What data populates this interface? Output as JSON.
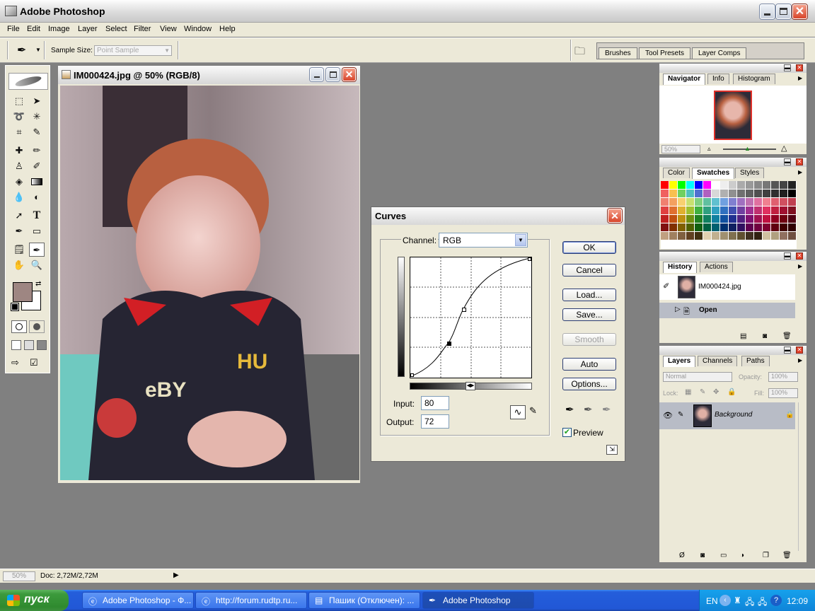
{
  "window": {
    "title": "Adobe Photoshop"
  },
  "menu": [
    "File",
    "Edit",
    "Image",
    "Layer",
    "Select",
    "Filter",
    "View",
    "Window",
    "Help"
  ],
  "options": {
    "sample_size_label": "Sample Size:",
    "sample_size_value": "Point Sample"
  },
  "palette_well": [
    "Brushes",
    "Tool Presets",
    "Layer Comps"
  ],
  "document": {
    "title": "IM000424.jpg @ 50% (RGB/8)"
  },
  "curves": {
    "title": "Curves",
    "channel_label": "Channel:",
    "channel_value": "RGB",
    "buttons": {
      "ok": "OK",
      "cancel": "Cancel",
      "load": "Load...",
      "save": "Save...",
      "smooth": "Smooth",
      "auto": "Auto",
      "options": "Options..."
    },
    "input_label": "Input:",
    "input_value": "80",
    "output_label": "Output:",
    "output_value": "72",
    "preview_label": "Preview",
    "preview_checked": true
  },
  "navigator": {
    "tabs": [
      "Navigator",
      "Info",
      "Histogram"
    ],
    "zoom": "50%"
  },
  "swatches": {
    "tabs": [
      "Color",
      "Swatches",
      "Styles"
    ]
  },
  "history": {
    "tabs": [
      "History",
      "Actions"
    ],
    "snapshot": "IM000424.jpg",
    "state": "Open"
  },
  "layers": {
    "tabs": [
      "Layers",
      "Channels",
      "Paths"
    ],
    "blend_mode": "Normal",
    "opacity_label": "Opacity:",
    "opacity": "100%",
    "lock_label": "Lock:",
    "fill_label": "Fill:",
    "fill": "100%",
    "layer_name": "Background"
  },
  "status": {
    "zoom": "50%",
    "doc": "Doc: 2,72M/2,72M"
  },
  "taskbar": {
    "start": "пуск",
    "tasks": [
      "Adobe Photoshop - Ф...",
      "http://forum.rudtp.ru...",
      "Пашик (Отключен): ...",
      "Adobe Photoshop"
    ],
    "lang": "EN",
    "time": "12:09"
  }
}
